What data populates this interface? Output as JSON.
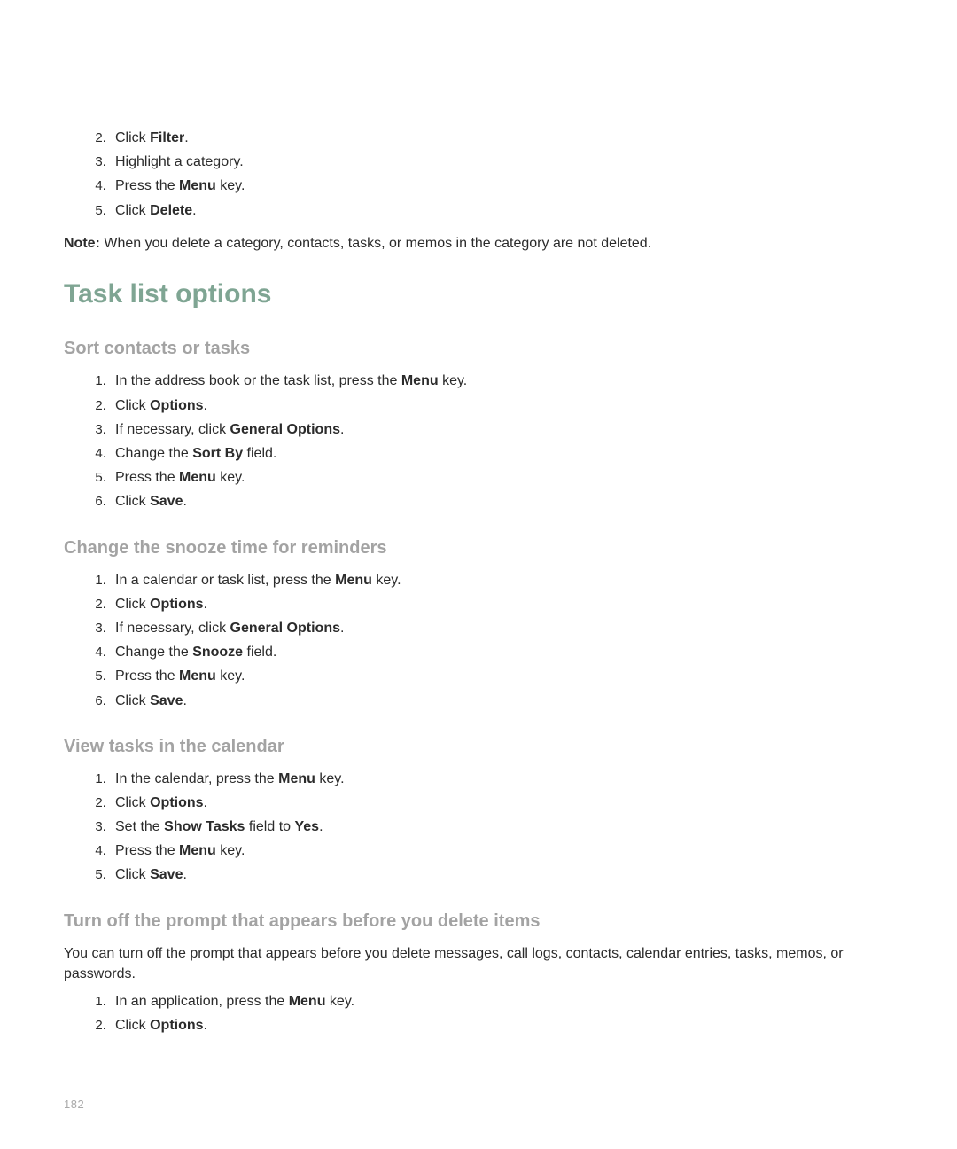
{
  "intro_steps": {
    "start": 2,
    "items": [
      {
        "pre": "Click ",
        "bold": "Filter",
        "post": "."
      },
      {
        "pre": "Highlight a category.",
        "bold": "",
        "post": ""
      },
      {
        "pre": "Press the ",
        "bold": "Menu",
        "post": " key."
      },
      {
        "pre": "Click ",
        "bold": "Delete",
        "post": "."
      }
    ]
  },
  "note": {
    "label": "Note:",
    "text": " When you delete a category, contacts, tasks, or memos in the category are not deleted."
  },
  "section_heading": "Task list options",
  "sort": {
    "heading": "Sort contacts or tasks",
    "steps": [
      {
        "pre": "In the address book or the task list, press the ",
        "bold": "Menu",
        "post": " key."
      },
      {
        "pre": "Click ",
        "bold": "Options",
        "post": "."
      },
      {
        "pre": "If necessary, click ",
        "bold": "General Options",
        "post": "."
      },
      {
        "pre": "Change the ",
        "bold": "Sort By",
        "post": " field."
      },
      {
        "pre": "Press the ",
        "bold": "Menu",
        "post": " key."
      },
      {
        "pre": "Click ",
        "bold": "Save",
        "post": "."
      }
    ]
  },
  "snooze": {
    "heading": "Change the snooze time for reminders",
    "steps": [
      {
        "pre": "In a calendar or task list, press the ",
        "bold": "Menu",
        "post": " key."
      },
      {
        "pre": "Click ",
        "bold": "Options",
        "post": "."
      },
      {
        "pre": "If necessary, click ",
        "bold": "General Options",
        "post": "."
      },
      {
        "pre": "Change the ",
        "bold": "Snooze",
        "post": " field."
      },
      {
        "pre": "Press the ",
        "bold": "Menu",
        "post": " key."
      },
      {
        "pre": "Click ",
        "bold": "Save",
        "post": "."
      }
    ]
  },
  "view_tasks": {
    "heading": "View tasks in the calendar",
    "steps": [
      {
        "pre": "In the calendar, press the ",
        "bold": "Menu",
        "post": " key."
      },
      {
        "pre": "Click ",
        "bold": "Options",
        "post": "."
      },
      {
        "pre": "Set the ",
        "bold": "Show Tasks",
        "post": " field to ",
        "bold2": "Yes",
        "post2": "."
      },
      {
        "pre": "Press the ",
        "bold": "Menu",
        "post": " key."
      },
      {
        "pre": "Click ",
        "bold": "Save",
        "post": "."
      }
    ]
  },
  "turn_off": {
    "heading": "Turn off the prompt that appears before you delete items",
    "intro": "You can turn off the prompt that appears before you delete messages, call logs, contacts, calendar entries, tasks, memos, or passwords.",
    "steps": [
      {
        "pre": "In an application, press the ",
        "bold": "Menu",
        "post": " key."
      },
      {
        "pre": "Click ",
        "bold": "Options",
        "post": "."
      }
    ]
  },
  "page_number": "182"
}
